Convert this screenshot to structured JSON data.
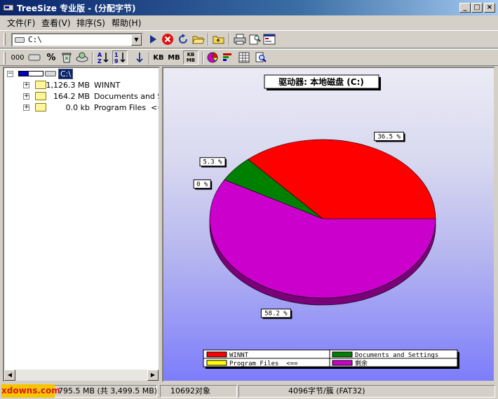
{
  "window": {
    "title": "TreeSize 专业版 - (分配字节)",
    "buttons": {
      "minimize": "_",
      "maximize": "□",
      "close": "×"
    }
  },
  "menu": [
    {
      "label": "文件(F)"
    },
    {
      "label": "查看(V)"
    },
    {
      "label": "排序(S)"
    },
    {
      "label": "帮助(H)"
    }
  ],
  "toolbar": {
    "drive_value": "C:\\",
    "buttons": [
      {
        "icon": "go-arrow-icon"
      },
      {
        "icon": "stop-icon"
      },
      {
        "icon": "refresh-icon"
      },
      {
        "icon": "open-folder-icon"
      },
      {
        "icon": "up-folder-icon"
      },
      {
        "icon": "print-icon"
      },
      {
        "icon": "print-preview-icon"
      },
      {
        "icon": "export-icon"
      }
    ],
    "view_buttons": [
      {
        "label": "000"
      },
      {
        "label": "▭"
      },
      {
        "label": "%"
      },
      {
        "label": "♻"
      },
      {
        "label": "⊕"
      },
      {
        "label": "A↓Z"
      },
      {
        "label": "1↓9"
      },
      {
        "label": "↓"
      },
      {
        "label": "KB"
      },
      {
        "label": "MB"
      },
      {
        "label": "KB MB"
      },
      {
        "label": "◔"
      },
      {
        "label": "≡"
      },
      {
        "label": "▦"
      },
      {
        "label": "🔍"
      }
    ]
  },
  "tree": {
    "root_label": "C:\\",
    "items": [
      {
        "size": "1,126.3 MB",
        "name": "WINNT"
      },
      {
        "size": "164.2 MB",
        "name": "Documents and Settings"
      },
      {
        "size": "0.0 kb",
        "name": "Program Files  <=="
      }
    ]
  },
  "chart_data": {
    "type": "pie",
    "title": "驱动器: 本地磁盘 (C:)",
    "categories": [
      "WINNT",
      "Documents and Settings",
      "Program Files  <==",
      "剩余"
    ],
    "values": [
      36.5,
      5.3,
      0.0,
      58.2
    ],
    "labels": [
      "36.5 %",
      "5.3 %",
      "0 %",
      "58.2 %"
    ],
    "colors": [
      "#ff0000",
      "#008000",
      "#ffff00",
      "#cc00cc"
    ],
    "legend_position": "bottom"
  },
  "status": {
    "watermark": "xdowns.com",
    "free": "795.5 MB (共 3,499.5 MB)",
    "objects": "10692对象",
    "cluster": "4096字节/簇 (FAT32)"
  }
}
